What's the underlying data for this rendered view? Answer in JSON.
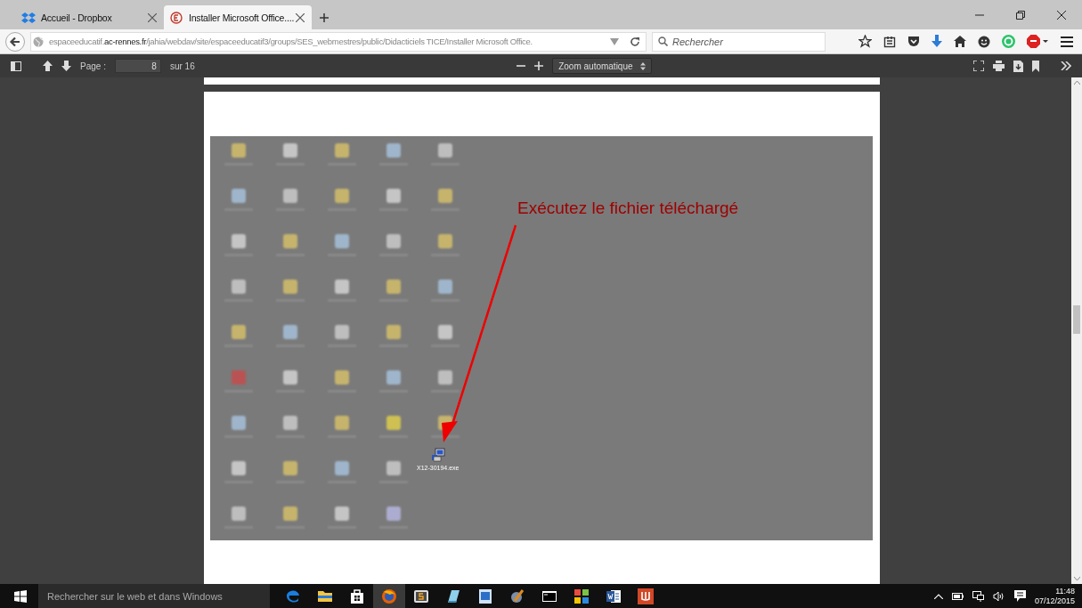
{
  "tabs": [
    {
      "title": "Accueil - Dropbox",
      "selected": false
    },
    {
      "title": "Installer Microsoft Office....",
      "selected": true
    }
  ],
  "address_bar": {
    "url_prefix": "espaceeducatif.",
    "url_host": "ac-rennes.fr",
    "url_path": "/jahia/webdav/site/espaceeducatif3/groups/SES_webmestres/public/Didacticiels TICE/Installer Microsoft Office."
  },
  "search": {
    "placeholder": "Rechercher"
  },
  "pdf_toolbar": {
    "page_label": "Page :",
    "page_value": "8",
    "page_count": "sur 16",
    "zoom": "Zoom automatique"
  },
  "document": {
    "annotation": "Exécutez le fichier téléchargé",
    "file_label": "X12-30194.exe"
  },
  "taskbar": {
    "search_placeholder": "Rechercher sur le web et dans Windows",
    "apps": [
      {
        "kind": "edge",
        "selected": false
      },
      {
        "kind": "folder",
        "selected": false
      },
      {
        "kind": "store",
        "selected": false
      },
      {
        "kind": "firefox",
        "selected": true
      },
      {
        "kind": "editor",
        "selected": false
      },
      {
        "kind": "notepad",
        "selected": false
      },
      {
        "kind": "document",
        "selected": false
      },
      {
        "kind": "tools",
        "selected": false
      },
      {
        "kind": "terminal",
        "selected": false
      },
      {
        "kind": "tiles",
        "selected": false
      },
      {
        "kind": "word",
        "selected": false
      },
      {
        "kind": "pdf",
        "selected": false
      }
    ],
    "clock": {
      "time": "11:48",
      "date": "07/12/2015"
    }
  }
}
